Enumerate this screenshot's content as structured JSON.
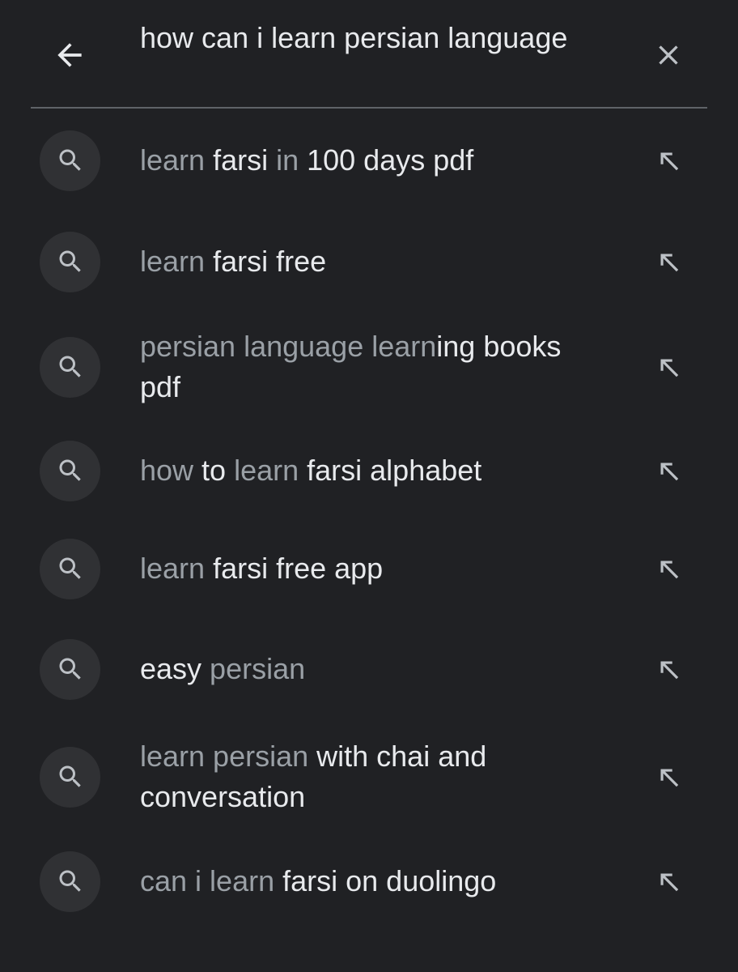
{
  "header": {
    "query": "how can i learn persian language",
    "back_icon": "arrow-left-icon",
    "clear_icon": "close-icon"
  },
  "colors": {
    "background": "#202124",
    "text_primary": "#e8eaed",
    "text_dim": "#9aa0a6",
    "icon_circle": "#303134",
    "divider": "#5f6368"
  },
  "suggestions": [
    {
      "parts": [
        {
          "text": "learn",
          "dim": true
        },
        {
          "text": " farsi ",
          "dim": false
        },
        {
          "text": "in",
          "dim": true
        },
        {
          "text": " 100 days pdf",
          "dim": false
        }
      ]
    },
    {
      "parts": [
        {
          "text": "learn",
          "dim": true
        },
        {
          "text": " farsi free",
          "dim": false
        }
      ]
    },
    {
      "parts": [
        {
          "text": "persian language learn",
          "dim": true
        },
        {
          "text": "ing books pdf",
          "dim": false
        }
      ]
    },
    {
      "parts": [
        {
          "text": "how",
          "dim": true
        },
        {
          "text": " to ",
          "dim": false
        },
        {
          "text": "learn",
          "dim": true
        },
        {
          "text": " farsi alphabet",
          "dim": false
        }
      ]
    },
    {
      "parts": [
        {
          "text": "learn",
          "dim": true
        },
        {
          "text": " farsi free app",
          "dim": false
        }
      ]
    },
    {
      "parts": [
        {
          "text": "easy ",
          "dim": false
        },
        {
          "text": "persian",
          "dim": true
        }
      ]
    },
    {
      "parts": [
        {
          "text": "learn persian",
          "dim": true
        },
        {
          "text": " with chai and conversation",
          "dim": false
        }
      ]
    },
    {
      "parts": [
        {
          "text": "can i learn",
          "dim": true
        },
        {
          "text": " farsi on duolingo",
          "dim": false
        }
      ]
    }
  ],
  "suggestion_icon": "search-icon",
  "fill_icon": "arrow-up-left-icon"
}
